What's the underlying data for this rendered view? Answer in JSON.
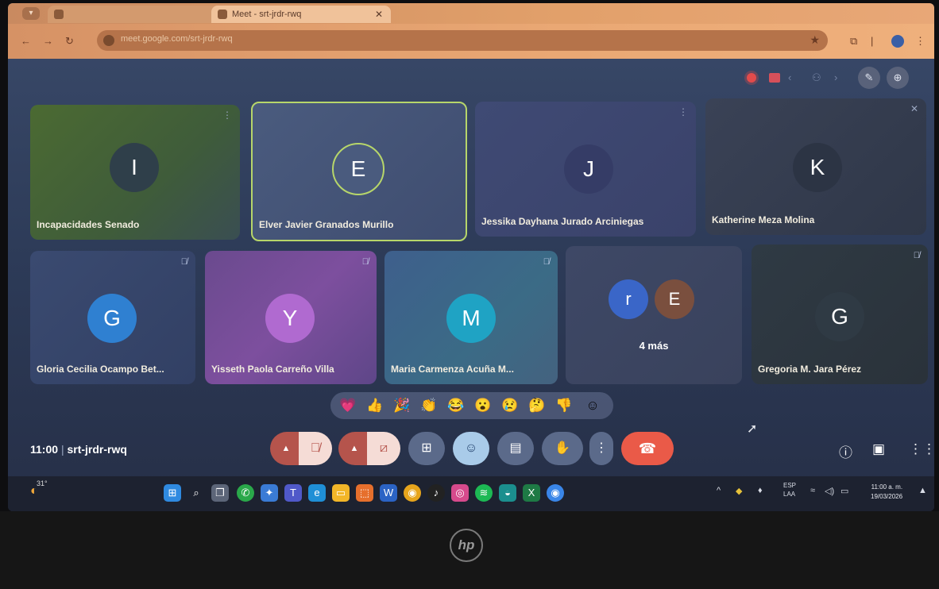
{
  "browser": {
    "tabs": [
      {
        "label": "",
        "active": false
      },
      {
        "label": "Meet - srt-jrdr-rwq",
        "active": true
      }
    ],
    "url": "meet.google.com/srt-jrdr-rwq"
  },
  "meet": {
    "status_icons": [
      "recording-icon",
      "camera-off-icon",
      "chevron-left-icon",
      "people-icon",
      "edit-icon",
      "apps-icon"
    ],
    "tiles": [
      {
        "initial": "I",
        "name": "Incapacidades Senado",
        "avatar_color": "#2f3f4a"
      },
      {
        "initial": "E",
        "name": "Elver Javier Granados Murillo",
        "avatar_color": "#4a5b7e",
        "speaking": true
      },
      {
        "initial": "J",
        "name": "Jessika Dayhana Jurado Arciniegas",
        "avatar_color": "#353c66"
      },
      {
        "initial": "K",
        "name": "Katherine Meza Molina",
        "avatar_color": "#2c3444"
      },
      {
        "initial": "G",
        "name": "Gloria Cecilia Ocampo Bet...",
        "avatar_color": "#2f80d1"
      },
      {
        "initial": "Y",
        "name": "Yisseth Paola Carreño Villa",
        "avatar_color": "#b06ad0"
      },
      {
        "initial": "M",
        "name": "Maria Carmenza Acuña M...",
        "avatar_color": "#1fa3c4"
      },
      {
        "initial": "G",
        "name": "Gregoria M. Jara Pérez",
        "avatar_color": "#2f3a44"
      }
    ],
    "others": {
      "initials": [
        "r",
        "E"
      ],
      "colors": [
        "#3a66c8",
        "#7a4f3e"
      ],
      "count_label": "4 más"
    },
    "reactions": [
      "heart",
      "thumbs-up",
      "party",
      "clap",
      "smile",
      "surprised",
      "sad",
      "thinking",
      "thumbs-down",
      "add-reaction"
    ],
    "meeting": {
      "time": "11:00",
      "code": "srt-jrdr-rwq"
    }
  },
  "taskbar": {
    "temperature": "31°",
    "language": {
      "line1": "ESP",
      "line2": "LAA"
    },
    "clock": {
      "time": "11:00 a. m.",
      "date": "19/03/2026"
    }
  },
  "laptop": {
    "logo": "hp"
  }
}
